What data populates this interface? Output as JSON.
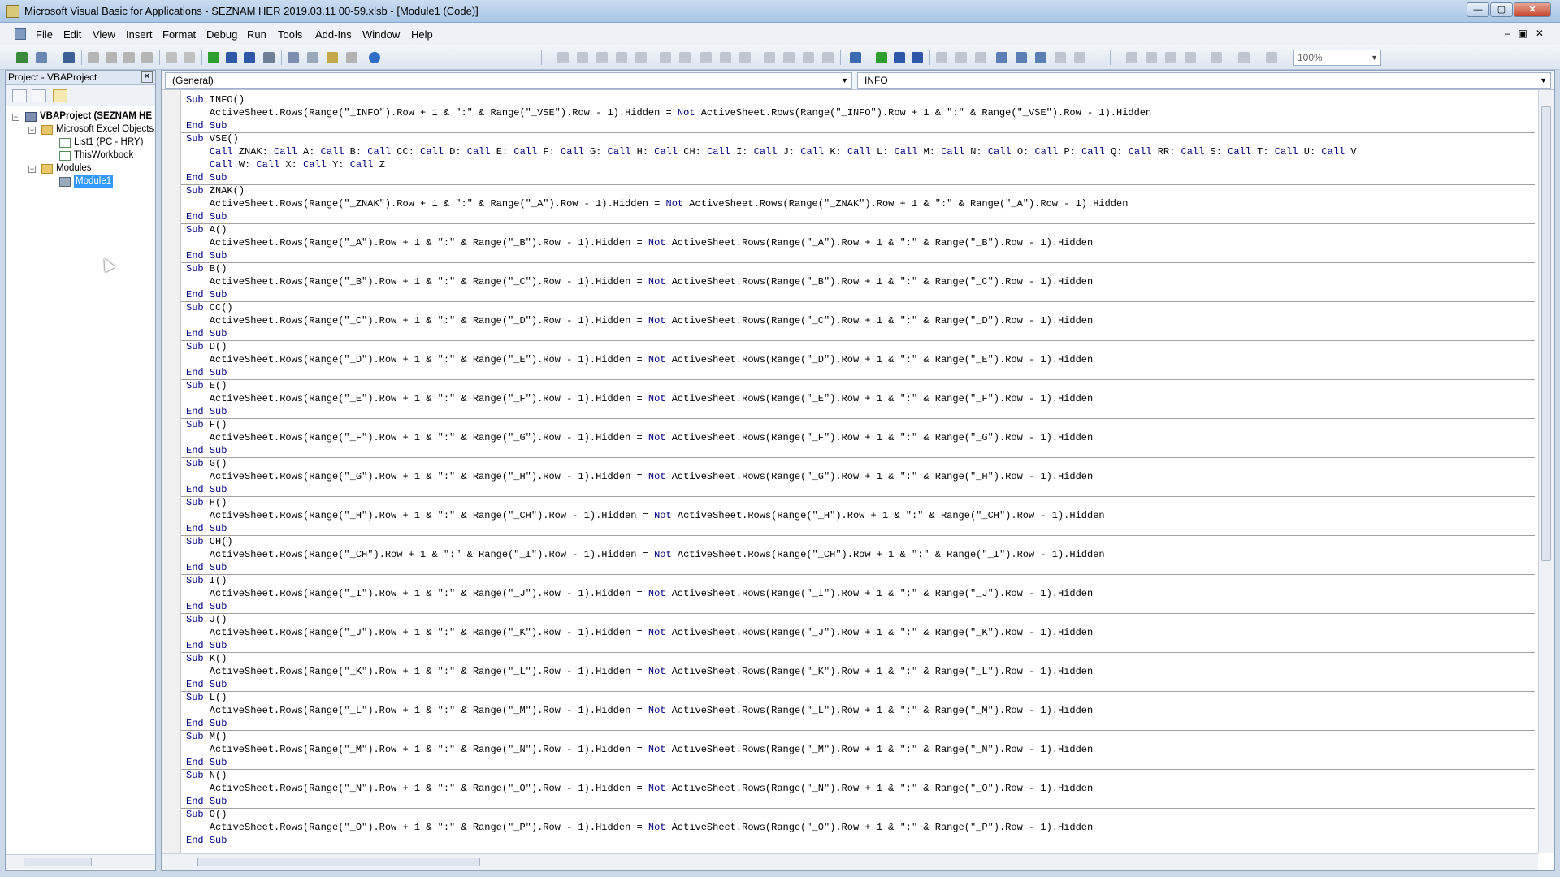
{
  "window": {
    "title": "Microsoft Visual Basic for Applications - SEZNAM HER 2019.03.11 00-59.xlsb - [Module1 (Code)]"
  },
  "menu": [
    "File",
    "Edit",
    "View",
    "Insert",
    "Format",
    "Debug",
    "Run",
    "Tools",
    "Add-Ins",
    "Window",
    "Help"
  ],
  "toolbar": {
    "zoom": "100%"
  },
  "project": {
    "header": "Project - VBAProject",
    "root": "VBAProject (SEZNAM HE",
    "excel_objects": "Microsoft Excel Objects",
    "list1": "List1 (PC - HRY)",
    "this_workbook": "ThisWorkbook",
    "modules": "Modules",
    "module1": "Module1"
  },
  "code": {
    "object_dropdown": "(General)",
    "procedure_dropdown": "INFO",
    "lines": [
      "Sub INFO()",
      "    ActiveSheet.Rows(Range(\"_INFO\").Row + 1 & \":\" & Range(\"_VSE\").Row - 1).Hidden = Not ActiveSheet.Rows(Range(\"_INFO\").Row + 1 & \":\" & Range(\"_VSE\").Row - 1).Hidden",
      "End Sub",
      "Sub VSE()",
      "    Call ZNAK: Call A: Call B: Call CC: Call D: Call E: Call F: Call G: Call H: Call CH: Call I: Call J: Call K: Call L: Call M: Call N: Call O: Call P: Call Q: Call RR: Call S: Call T: Call U: Call V",
      "    Call W: Call X: Call Y: Call Z",
      "End Sub",
      "Sub ZNAK()",
      "    ActiveSheet.Rows(Range(\"_ZNAK\").Row + 1 & \":\" & Range(\"_A\").Row - 1).Hidden = Not ActiveSheet.Rows(Range(\"_ZNAK\").Row + 1 & \":\" & Range(\"_A\").Row - 1).Hidden",
      "End Sub",
      "Sub A()",
      "    ActiveSheet.Rows(Range(\"_A\").Row + 1 & \":\" & Range(\"_B\").Row - 1).Hidden = Not ActiveSheet.Rows(Range(\"_A\").Row + 1 & \":\" & Range(\"_B\").Row - 1).Hidden",
      "End Sub",
      "Sub B()",
      "    ActiveSheet.Rows(Range(\"_B\").Row + 1 & \":\" & Range(\"_C\").Row - 1).Hidden = Not ActiveSheet.Rows(Range(\"_B\").Row + 1 & \":\" & Range(\"_C\").Row - 1).Hidden",
      "End Sub",
      "Sub CC()",
      "    ActiveSheet.Rows(Range(\"_C\").Row + 1 & \":\" & Range(\"_D\").Row - 1).Hidden = Not ActiveSheet.Rows(Range(\"_C\").Row + 1 & \":\" & Range(\"_D\").Row - 1).Hidden",
      "End Sub",
      "Sub D()",
      "    ActiveSheet.Rows(Range(\"_D\").Row + 1 & \":\" & Range(\"_E\").Row - 1).Hidden = Not ActiveSheet.Rows(Range(\"_D\").Row + 1 & \":\" & Range(\"_E\").Row - 1).Hidden",
      "End Sub",
      "Sub E()",
      "    ActiveSheet.Rows(Range(\"_E\").Row + 1 & \":\" & Range(\"_F\").Row - 1).Hidden = Not ActiveSheet.Rows(Range(\"_E\").Row + 1 & \":\" & Range(\"_F\").Row - 1).Hidden",
      "End Sub",
      "Sub F()",
      "    ActiveSheet.Rows(Range(\"_F\").Row + 1 & \":\" & Range(\"_G\").Row - 1).Hidden = Not ActiveSheet.Rows(Range(\"_F\").Row + 1 & \":\" & Range(\"_G\").Row - 1).Hidden",
      "End Sub",
      "Sub G()",
      "    ActiveSheet.Rows(Range(\"_G\").Row + 1 & \":\" & Range(\"_H\").Row - 1).Hidden = Not ActiveSheet.Rows(Range(\"_G\").Row + 1 & \":\" & Range(\"_H\").Row - 1).Hidden",
      "End Sub",
      "Sub H()",
      "    ActiveSheet.Rows(Range(\"_H\").Row + 1 & \":\" & Range(\"_CH\").Row - 1).Hidden = Not ActiveSheet.Rows(Range(\"_H\").Row + 1 & \":\" & Range(\"_CH\").Row - 1).Hidden",
      "End Sub",
      "Sub CH()",
      "    ActiveSheet.Rows(Range(\"_CH\").Row + 1 & \":\" & Range(\"_I\").Row - 1).Hidden = Not ActiveSheet.Rows(Range(\"_CH\").Row + 1 & \":\" & Range(\"_I\").Row - 1).Hidden",
      "End Sub",
      "Sub I()",
      "    ActiveSheet.Rows(Range(\"_I\").Row + 1 & \":\" & Range(\"_J\").Row - 1).Hidden = Not ActiveSheet.Rows(Range(\"_I\").Row + 1 & \":\" & Range(\"_J\").Row - 1).Hidden",
      "End Sub",
      "Sub J()",
      "    ActiveSheet.Rows(Range(\"_J\").Row + 1 & \":\" & Range(\"_K\").Row - 1).Hidden = Not ActiveSheet.Rows(Range(\"_J\").Row + 1 & \":\" & Range(\"_K\").Row - 1).Hidden",
      "End Sub",
      "Sub K()",
      "    ActiveSheet.Rows(Range(\"_K\").Row + 1 & \":\" & Range(\"_L\").Row - 1).Hidden = Not ActiveSheet.Rows(Range(\"_K\").Row + 1 & \":\" & Range(\"_L\").Row - 1).Hidden",
      "End Sub",
      "Sub L()",
      "    ActiveSheet.Rows(Range(\"_L\").Row + 1 & \":\" & Range(\"_M\").Row - 1).Hidden = Not ActiveSheet.Rows(Range(\"_L\").Row + 1 & \":\" & Range(\"_M\").Row - 1).Hidden",
      "End Sub",
      "Sub M()",
      "    ActiveSheet.Rows(Range(\"_M\").Row + 1 & \":\" & Range(\"_N\").Row - 1).Hidden = Not ActiveSheet.Rows(Range(\"_M\").Row + 1 & \":\" & Range(\"_N\").Row - 1).Hidden",
      "End Sub",
      "Sub N()",
      "    ActiveSheet.Rows(Range(\"_N\").Row + 1 & \":\" & Range(\"_O\").Row - 1).Hidden = Not ActiveSheet.Rows(Range(\"_N\").Row + 1 & \":\" & Range(\"_O\").Row - 1).Hidden",
      "End Sub",
      "Sub O()",
      "    ActiveSheet.Rows(Range(\"_O\").Row + 1 & \":\" & Range(\"_P\").Row - 1).Hidden = Not ActiveSheet.Rows(Range(\"_O\").Row + 1 & \":\" & Range(\"_P\").Row - 1).Hidden",
      "End Sub"
    ]
  }
}
